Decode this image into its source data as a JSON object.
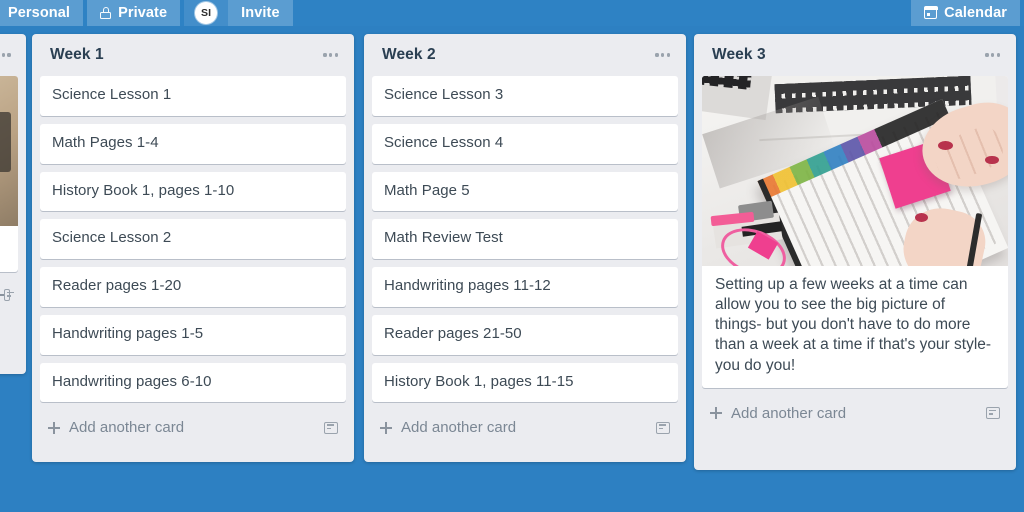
{
  "header": {
    "personal_label": "Personal",
    "visibility_label": "Private",
    "visibility_icon": "lock-icon",
    "avatar_initials": "SI",
    "invite_label": "Invite",
    "calendar_label": "Calendar",
    "calendar_icon": "calendar-icon",
    "background_color": "#2e82c4"
  },
  "board": {
    "background_color": "#2d80c2",
    "list_background_color": "#ebecf0",
    "card_background_color": "#ffffff",
    "add_card_label": "Add another card",
    "add_card_icon": "plus-icon",
    "template_icon": "card-template-icon",
    "list_menu_icon": "list-menu-dots-icon",
    "lists": [
      {
        "title": "Week 1",
        "cards": [
          "Science Lesson 1",
          "Math Pages 1-4",
          "History Book 1, pages 1-10",
          "Science Lesson 2",
          "Reader pages 1-20",
          "Handwriting pages 1-5",
          "Handwriting pages 6-10"
        ]
      },
      {
        "title": "Week 2",
        "cards": [
          "Science Lesson 3",
          "Science Lesson 4",
          "Math Page 5",
          "Math Review Test",
          "Handwriting pages 11-12",
          "Reader pages 21-50",
          "History Book 1, pages 11-15"
        ]
      },
      {
        "title": "Week 3",
        "photo_card": {
          "image_alt": "Hands placing a pink sticky note into a tabbed planner on a white desk next to a laptop",
          "text": "Setting up a few weeks at a time can allow you to see the big picture of things- but you don't have to do more than a week at a time if that's your style- you do you!"
        },
        "cards": []
      }
    ]
  }
}
